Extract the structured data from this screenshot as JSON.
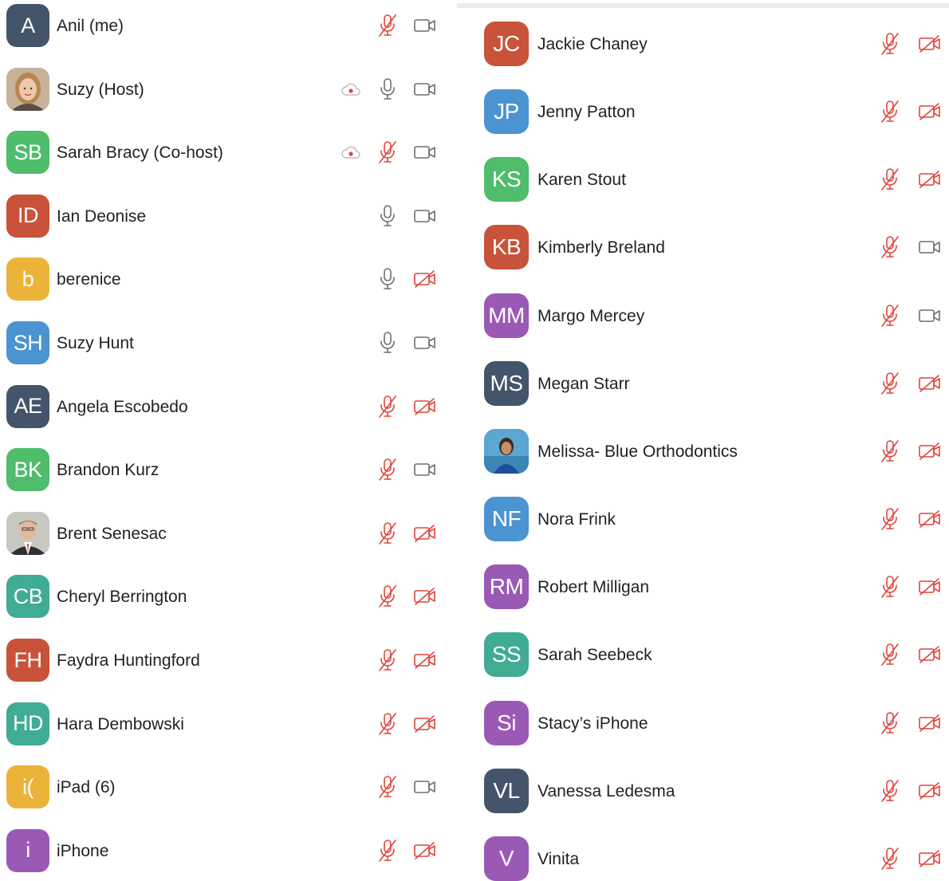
{
  "colors": {
    "muted_red": "#e0453b",
    "icon_gray": "#6e6e73",
    "record_red": "#e0453b"
  },
  "left_column": [
    {
      "initials": "A",
      "name": "Anil (me)",
      "avatar_color": "#44546a",
      "photo": null,
      "recording": false,
      "mic": "muted",
      "video": "on"
    },
    {
      "initials": "",
      "name": "Suzy (Host)",
      "avatar_color": "#c9b59a",
      "photo": "woman-portrait",
      "recording": true,
      "mic": "on",
      "video": "on"
    },
    {
      "initials": "SB",
      "name": "Sarah Bracy (Co-host)",
      "avatar_color": "#4fbd6b",
      "photo": null,
      "recording": true,
      "mic": "muted",
      "video": "on"
    },
    {
      "initials": "ID",
      "name": "Ian Deonise",
      "avatar_color": "#c9533a",
      "photo": null,
      "recording": false,
      "mic": "on",
      "video": "on"
    },
    {
      "initials": "b",
      "name": "berenice",
      "avatar_color": "#ecb33a",
      "photo": null,
      "recording": false,
      "mic": "on",
      "video": "off"
    },
    {
      "initials": "SH",
      "name": "Suzy Hunt",
      "avatar_color": "#4b93d1",
      "photo": null,
      "recording": false,
      "mic": "on",
      "video": "on"
    },
    {
      "initials": "AE",
      "name": "Angela Escobedo",
      "avatar_color": "#44546a",
      "photo": null,
      "recording": false,
      "mic": "muted",
      "video": "off"
    },
    {
      "initials": "BK",
      "name": "Brandon Kurz",
      "avatar_color": "#4fbd6b",
      "photo": null,
      "recording": false,
      "mic": "muted",
      "video": "on"
    },
    {
      "initials": "",
      "name": "Brent Senesac",
      "avatar_color": "#8d8f93",
      "photo": "man-portrait",
      "recording": false,
      "mic": "muted",
      "video": "off"
    },
    {
      "initials": "CB",
      "name": "Cheryl Berrington",
      "avatar_color": "#3fac93",
      "photo": null,
      "recording": false,
      "mic": "muted",
      "video": "off"
    },
    {
      "initials": "FH",
      "name": "Faydra Huntingford",
      "avatar_color": "#c9533a",
      "photo": null,
      "recording": false,
      "mic": "muted",
      "video": "off"
    },
    {
      "initials": "HD",
      "name": "Hara Dembowski",
      "avatar_color": "#3fac93",
      "photo": null,
      "recording": false,
      "mic": "muted",
      "video": "off"
    },
    {
      "initials": "i(",
      "name": "iPad (6)",
      "avatar_color": "#ecb33a",
      "photo": null,
      "recording": false,
      "mic": "muted",
      "video": "on"
    },
    {
      "initials": "i",
      "name": "iPhone",
      "avatar_color": "#9b59b6",
      "photo": null,
      "recording": false,
      "mic": "muted",
      "video": "off"
    }
  ],
  "right_column": [
    {
      "initials": "JC",
      "name": "Jackie Chaney",
      "avatar_color": "#c9533a",
      "photo": null,
      "mic": "muted",
      "video": "off"
    },
    {
      "initials": "JP",
      "name": "Jenny Patton",
      "avatar_color": "#4b93d1",
      "photo": null,
      "mic": "muted",
      "video": "off"
    },
    {
      "initials": "KS",
      "name": "Karen Stout",
      "avatar_color": "#4fbd6b",
      "photo": null,
      "mic": "muted",
      "video": "off"
    },
    {
      "initials": "KB",
      "name": "Kimberly Breland",
      "avatar_color": "#c9533a",
      "photo": null,
      "mic": "muted",
      "video": "on"
    },
    {
      "initials": "MM",
      "name": "Margo Mercey",
      "avatar_color": "#9b59b6",
      "photo": null,
      "mic": "muted",
      "video": "on"
    },
    {
      "initials": "MS",
      "name": "Megan Starr",
      "avatar_color": "#44546a",
      "photo": null,
      "mic": "muted",
      "video": "off"
    },
    {
      "initials": "",
      "name": "Melissa- Blue Orthodontics",
      "avatar_color": "#3f8fc4",
      "photo": "woman-blue-portrait",
      "mic": "muted",
      "video": "off"
    },
    {
      "initials": "NF",
      "name": "Nora Frink",
      "avatar_color": "#4b93d1",
      "photo": null,
      "mic": "muted",
      "video": "off"
    },
    {
      "initials": "RM",
      "name": "Robert Milligan",
      "avatar_color": "#9b59b6",
      "photo": null,
      "mic": "muted",
      "video": "off"
    },
    {
      "initials": "SS",
      "name": "Sarah Seebeck",
      "avatar_color": "#3fac93",
      "photo": null,
      "mic": "muted",
      "video": "off"
    },
    {
      "initials": "Si",
      "name": "Stacy’s iPhone",
      "avatar_color": "#9b59b6",
      "photo": null,
      "mic": "muted",
      "video": "off"
    },
    {
      "initials": "VL",
      "name": "Vanessa Ledesma",
      "avatar_color": "#44546a",
      "photo": null,
      "mic": "muted",
      "video": "off"
    },
    {
      "initials": "V",
      "name": "Vinita",
      "avatar_color": "#9b59b6",
      "photo": null,
      "mic": "muted",
      "video": "off"
    }
  ]
}
